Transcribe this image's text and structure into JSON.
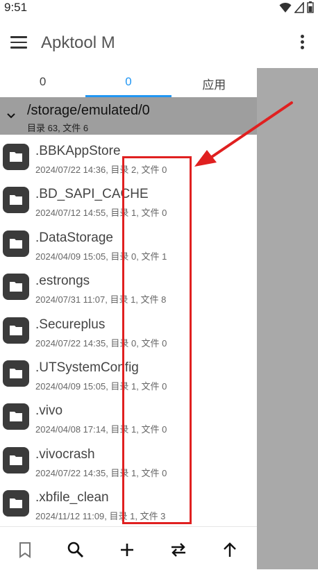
{
  "status_bar": {
    "time": "9:51",
    "icons": [
      "wifi-icon",
      "signal-icon",
      "battery-icon"
    ]
  },
  "app_bar": {
    "title": "Apktool M",
    "menu_icon": "menu-icon",
    "more_icon": "more-vert-icon"
  },
  "tabs": [
    {
      "label": "0",
      "active": false
    },
    {
      "label": "0",
      "active": true
    },
    {
      "label": "应用",
      "active": false
    }
  ],
  "path_header": {
    "path": "/storage/emulated/0",
    "summary": "目录 63, 文件 6"
  },
  "files": [
    {
      "name": ".BBKAppStore",
      "meta": "2024/07/22 14:36, 目录 2, 文件 0"
    },
    {
      "name": ".BD_SAPI_CACHE",
      "meta": "2024/07/12 14:55, 目录 1, 文件 0"
    },
    {
      "name": ".DataStorage",
      "meta": "2024/04/09 15:05, 目录 0, 文件 1"
    },
    {
      "name": ".estrongs",
      "meta": "2024/07/31 11:07, 目录 1, 文件 8"
    },
    {
      "name": ".Secureplus",
      "meta": "2024/07/22 14:35, 目录 0, 文件 0"
    },
    {
      "name": ".UTSystemConfig",
      "meta": "2024/04/09 15:05, 目录 1, 文件 0"
    },
    {
      "name": ".vivo",
      "meta": "2024/04/08 17:14, 目录 1, 文件 0"
    },
    {
      "name": ".vivocrash",
      "meta": "2024/07/22 14:35, 目录 1, 文件 0"
    },
    {
      "name": ".xbfile_clean",
      "meta": "2024/11/12 11:09, 目录 1, 文件 3"
    }
  ],
  "bottom_bar": [
    "bookmark-icon",
    "search-icon",
    "add-icon",
    "swap-icon",
    "arrow-up-icon"
  ],
  "colors": {
    "accent": "#2196f3",
    "header_bg": "#9e9e9e",
    "annotation": "#e02020",
    "folder_icon": "#3b3b3b"
  }
}
